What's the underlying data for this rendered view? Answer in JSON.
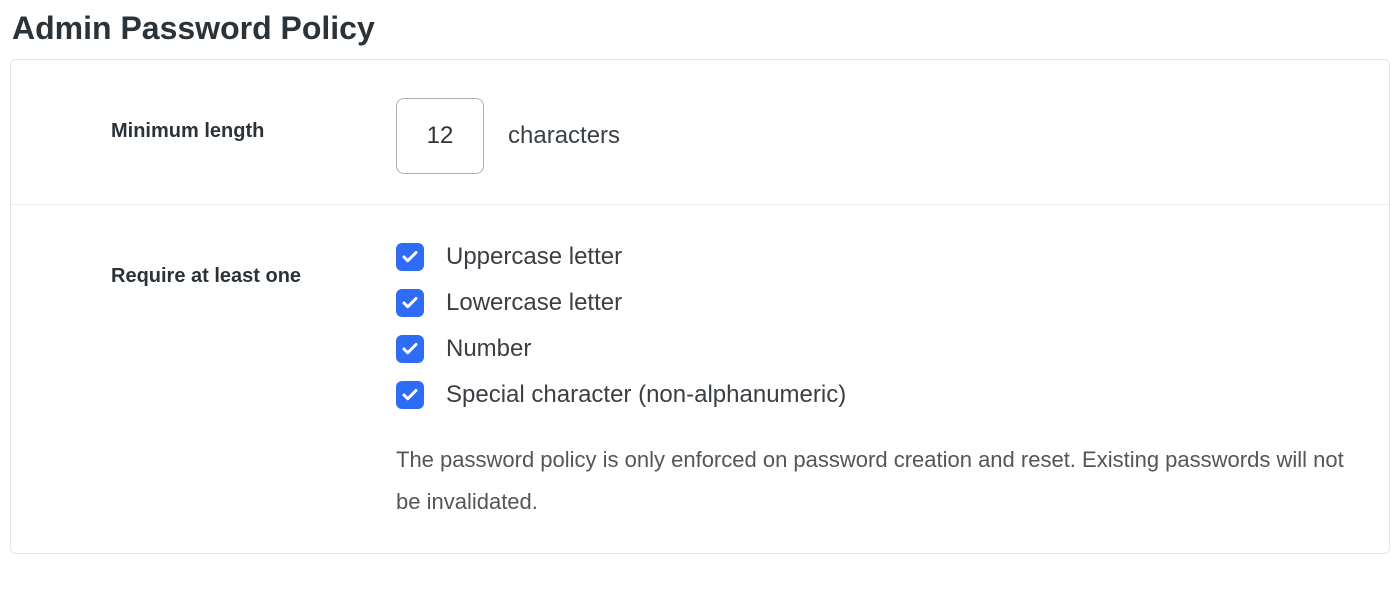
{
  "title": "Admin Password Policy",
  "min_length": {
    "label": "Minimum length",
    "value": "12",
    "unit": "characters"
  },
  "require": {
    "label": "Require at least one",
    "options": {
      "uppercase": "Uppercase letter",
      "lowercase": "Lowercase letter",
      "number": "Number",
      "special": "Special character (non-alphanumeric)"
    },
    "help": "The password policy is only enforced on password creation and reset. Existing passwords will not be invalidated."
  }
}
